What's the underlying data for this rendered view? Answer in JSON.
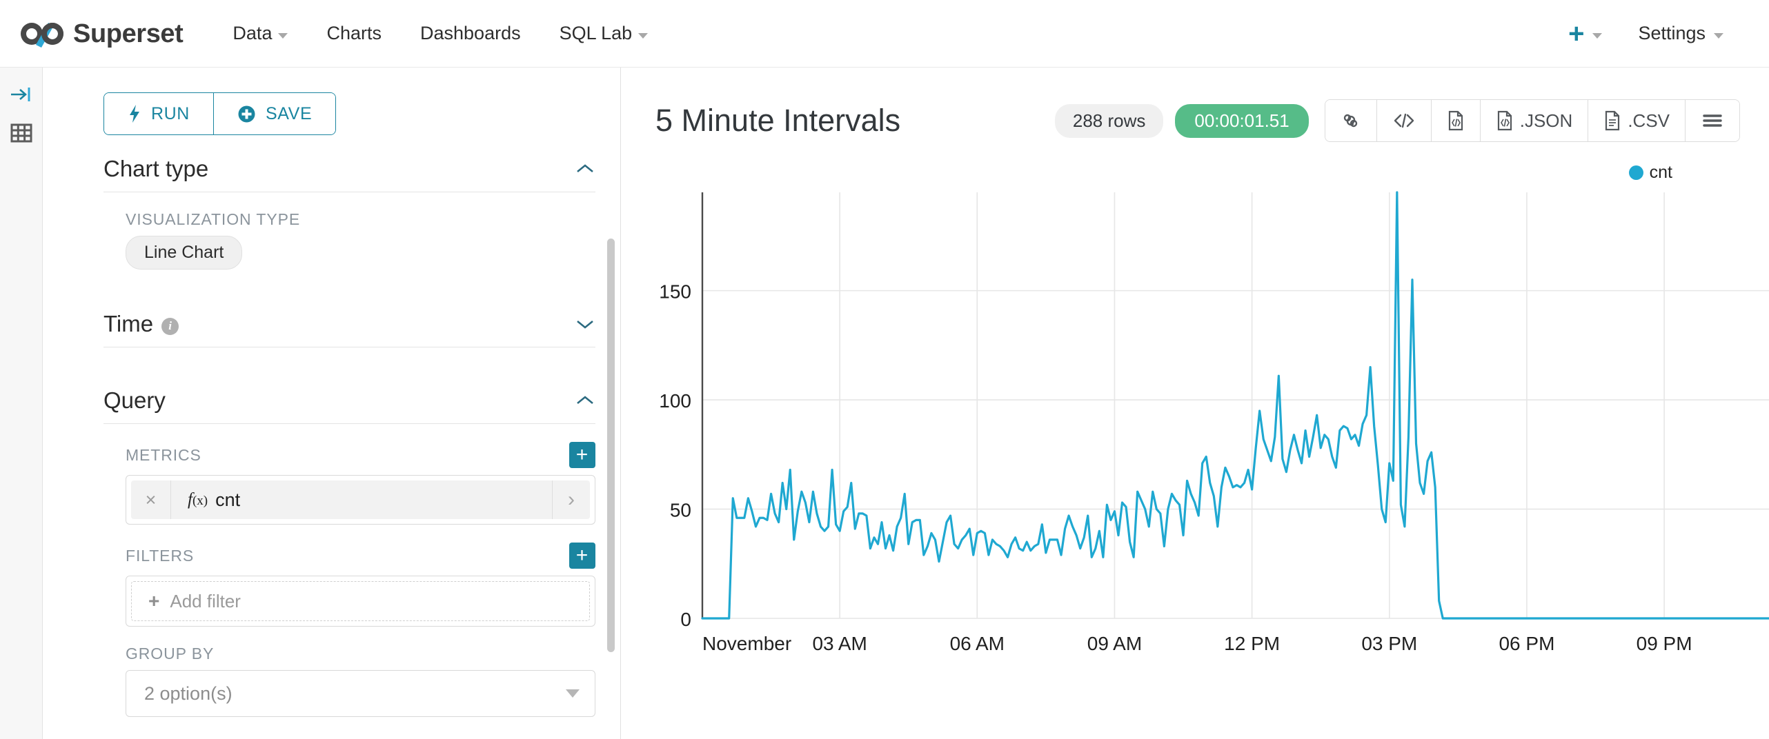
{
  "navbar": {
    "brand": "Superset",
    "brand_icon": "superset-infinity-logo",
    "links": [
      {
        "label": "Data",
        "has_caret": true
      },
      {
        "label": "Charts",
        "has_caret": false
      },
      {
        "label": "Dashboards",
        "has_caret": false
      },
      {
        "label": "SQL Lab",
        "has_caret": true
      }
    ],
    "plus_icon": "plus-icon",
    "settings_label": "Settings"
  },
  "rail": {
    "collapse_icon": "expand-panel-icon",
    "table_icon": "data-table-icon"
  },
  "control_panel": {
    "run_label": "RUN",
    "run_icon": "lightning-bolt-icon",
    "save_label": "SAVE",
    "save_icon": "plus-circle-icon",
    "sections": {
      "chart_type": {
        "title": "Chart type",
        "expanded": true
      },
      "time": {
        "title": "Time",
        "expanded": false,
        "info_icon": "info-icon"
      },
      "query": {
        "title": "Query",
        "expanded": true
      }
    },
    "visualization_type": {
      "label": "VISUALIZATION TYPE",
      "value": "Line Chart"
    },
    "metrics": {
      "label": "METRICS",
      "add_label": "+",
      "items": [
        {
          "remove": "×",
          "fx": "f",
          "fx_arg": "(x)",
          "name": "cnt",
          "chevron": "›"
        }
      ]
    },
    "filters": {
      "label": "FILTERS",
      "add_label": "+",
      "placeholder": "Add filter",
      "plus": "+"
    },
    "group_by": {
      "label": "GROUP BY",
      "value": "2 option(s)"
    }
  },
  "chart": {
    "title": "5 Minute Intervals",
    "rows_badge": "288 rows",
    "time_badge": "00:00:01.51",
    "tools": [
      {
        "name": "link-icon",
        "label": ""
      },
      {
        "name": "code-icon",
        "label": ""
      },
      {
        "name": "json-file-icon",
        "label": ""
      },
      {
        "name": "json-download",
        "label": ".JSON"
      },
      {
        "name": "csv-download",
        "label": ".CSV"
      },
      {
        "name": "hamburger-menu-icon",
        "label": ""
      }
    ],
    "legend": [
      {
        "label": "cnt",
        "color": "#1fa8d1"
      }
    ]
  },
  "chart_data": {
    "type": "line",
    "title": "5 Minute Intervals",
    "xlabel": "",
    "ylabel": "",
    "ylim": [
      0,
      195
    ],
    "yticks": [
      0,
      50,
      100,
      150
    ],
    "ytick_labels": [
      "0",
      "50",
      "100",
      "150"
    ],
    "xtick_labels": [
      "November",
      "03 AM",
      "06 AM",
      "09 AM",
      "12 PM",
      "03 PM",
      "06 PM",
      "09 PM"
    ],
    "xtick_positions": [
      0,
      36,
      72,
      108,
      144,
      180,
      216,
      252
    ],
    "x_total_points": 288,
    "grid": true,
    "legend_position": "top-right",
    "series": [
      {
        "name": "cnt",
        "color": "#1fa8d1",
        "values": [
          0,
          0,
          0,
          0,
          0,
          0,
          0,
          0,
          55,
          46,
          46,
          46,
          55,
          49,
          42,
          46,
          46,
          45,
          57,
          48,
          44,
          62,
          50,
          68,
          36,
          49,
          58,
          53,
          44,
          58,
          48,
          42,
          40,
          42,
          68,
          43,
          40,
          49,
          51,
          62,
          41,
          48,
          48,
          47,
          32,
          37,
          34,
          44,
          32,
          38,
          31,
          42,
          46,
          57,
          34,
          44,
          45,
          45,
          29,
          33,
          39,
          36,
          26,
          35,
          44,
          47,
          34,
          32,
          36,
          38,
          41,
          29,
          39,
          40,
          39,
          29,
          36,
          34,
          33,
          31,
          28,
          34,
          37,
          32,
          31,
          35,
          31,
          33,
          34,
          43,
          30,
          36,
          36,
          36,
          29,
          41,
          47,
          42,
          38,
          32,
          37,
          47,
          28,
          32,
          40,
          28,
          52,
          45,
          49,
          38,
          53,
          51,
          35,
          28,
          58,
          54,
          50,
          42,
          58,
          50,
          48,
          33,
          50,
          57,
          54,
          52,
          38,
          63,
          57,
          53,
          47,
          71,
          74,
          62,
          56,
          42,
          60,
          69,
          65,
          60,
          61,
          60,
          62,
          68,
          59,
          78,
          95,
          82,
          77,
          72,
          83,
          111,
          73,
          67,
          77,
          84,
          77,
          71,
          86,
          74,
          83,
          93,
          78,
          84,
          82,
          74,
          69,
          86,
          88,
          87,
          82,
          84,
          79,
          89,
          93,
          115,
          88,
          70,
          50,
          44,
          71,
          63,
          195,
          52,
          42,
          83,
          155,
          80,
          62,
          57,
          72,
          76,
          60,
          8,
          0,
          0,
          0,
          0,
          0,
          0,
          0,
          0,
          0,
          0,
          0,
          0,
          0,
          0,
          0,
          0,
          0,
          0,
          0,
          0,
          0,
          0,
          0,
          0,
          0,
          0,
          0,
          0,
          0,
          0,
          0,
          0,
          0,
          0,
          0,
          0,
          0,
          0,
          0,
          0,
          0,
          0,
          0,
          0,
          0,
          0,
          0,
          0,
          0,
          0,
          0,
          0,
          0,
          0,
          0,
          0,
          0,
          0,
          0,
          0,
          0,
          0,
          0,
          0,
          0,
          0,
          0,
          0,
          0,
          0,
          0,
          0,
          0,
          0,
          0,
          0,
          0,
          0,
          0,
          0,
          0,
          0,
          0,
          0,
          0,
          0,
          0
        ]
      }
    ]
  }
}
